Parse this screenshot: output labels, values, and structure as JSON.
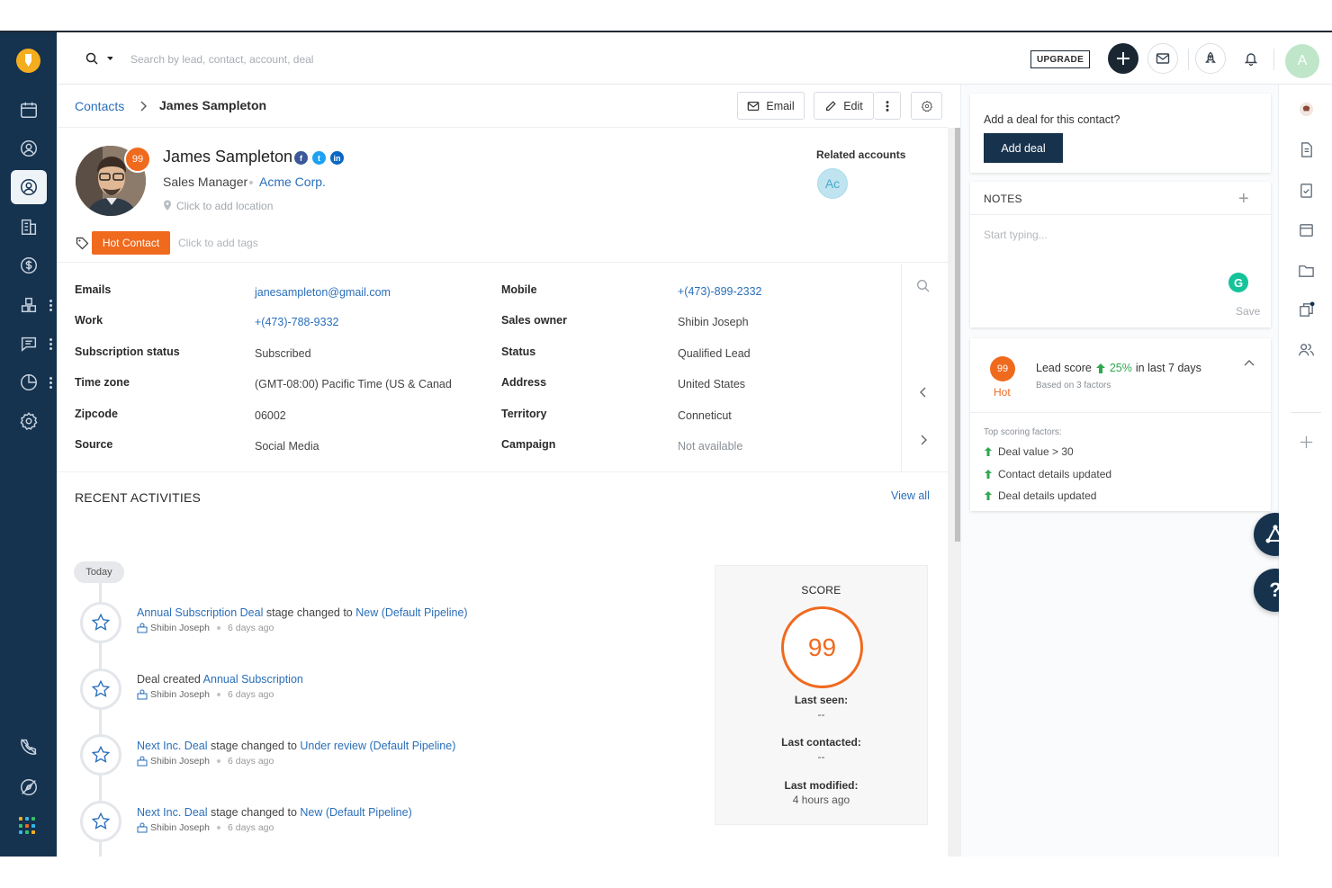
{
  "topbar": {
    "search_placeholder": "Search by lead, contact, account, deal",
    "upgrade_label": "UPGRADE",
    "avatar_initial": "A"
  },
  "breadcrumb": {
    "parent": "Contacts",
    "current": "James Sampleton"
  },
  "actions": {
    "email_label": "Email",
    "edit_label": "Edit"
  },
  "contact": {
    "name": "James Sampleton",
    "score": "99",
    "title": "Sales Manager",
    "company": "Acme Corp.",
    "location_hint": "Click to add location",
    "tag": "Hot Contact",
    "tags_hint": "Click to add tags",
    "related_title": "Related accounts",
    "related_initials": "Ac"
  },
  "details": {
    "left": [
      {
        "label": "Emails",
        "value": "janesampleton@gmail.com"
      },
      {
        "label": "Work",
        "value": "+(473)-788-9332"
      },
      {
        "label": "Subscription status",
        "value": "Subscribed"
      },
      {
        "label": "Time zone",
        "value": "(GMT-08:00) Pacific Time (US & Canad"
      },
      {
        "label": "Zipcode",
        "value": "06002"
      },
      {
        "label": "Source",
        "value": "Social Media"
      }
    ],
    "right": [
      {
        "label": "Mobile",
        "value": "+(473)-899-2332"
      },
      {
        "label": "Sales owner",
        "value": "Shibin Joseph"
      },
      {
        "label": "Status",
        "value": "Qualified Lead"
      },
      {
        "label": "Address",
        "value": "United States"
      },
      {
        "label": "Territory",
        "value": "Conneticut"
      },
      {
        "label": "Campaign",
        "value": "Not available"
      }
    ]
  },
  "activities": {
    "title": "RECENT ACTIVITIES",
    "view_all": "View all",
    "today": "Today",
    "items": [
      {
        "pre": "",
        "link1": "Annual Subscription Deal",
        "mid": " stage changed to ",
        "link2": "New (Default Pipeline)",
        "user": "Shibin Joseph",
        "time": "6 days ago"
      },
      {
        "pre": "Deal created ",
        "link1": "Annual Subscription",
        "mid": "",
        "link2": "",
        "user": "Shibin Joseph",
        "time": "6 days ago"
      },
      {
        "pre": "",
        "link1": "Next Inc. Deal",
        "mid": " stage changed to ",
        "link2": "Under review (Default Pipeline)",
        "user": "Shibin Joseph",
        "time": "6 days ago"
      },
      {
        "pre": "",
        "link1": "Next Inc. Deal",
        "mid": " stage changed to ",
        "link2": "New (Default Pipeline)",
        "user": "Shibin Joseph",
        "time": "6 days ago"
      }
    ]
  },
  "score_card": {
    "title": "SCORE",
    "value": "99",
    "last_seen_label": "Last seen:",
    "last_seen": "--",
    "last_contacted_label": "Last contacted:",
    "last_contacted": "--",
    "last_modified_label": "Last modified:",
    "last_modified": "4 hours ago"
  },
  "deal_card": {
    "question": "Add a deal for this contact?",
    "button": "Add deal"
  },
  "notes": {
    "title": "NOTES",
    "placeholder": "Start typing...",
    "save": "Save",
    "grammarly": "G"
  },
  "lead_score": {
    "score": "99",
    "label": "Hot",
    "title_pre": "Lead score",
    "percent": "25%",
    "title_post": "in last 7 days",
    "based_on": "Based on 3 factors",
    "factors_title": "Top scoring factors:",
    "factors": [
      "Deal value > 30",
      "Contact details updated",
      "Deal details updated"
    ]
  },
  "fab": {
    "help": "?"
  },
  "colors": {
    "nav_bg": "#15324f",
    "accent_orange": "#f06a1e",
    "link_blue": "#2a6fba",
    "positive_green": "#2fa84f"
  }
}
